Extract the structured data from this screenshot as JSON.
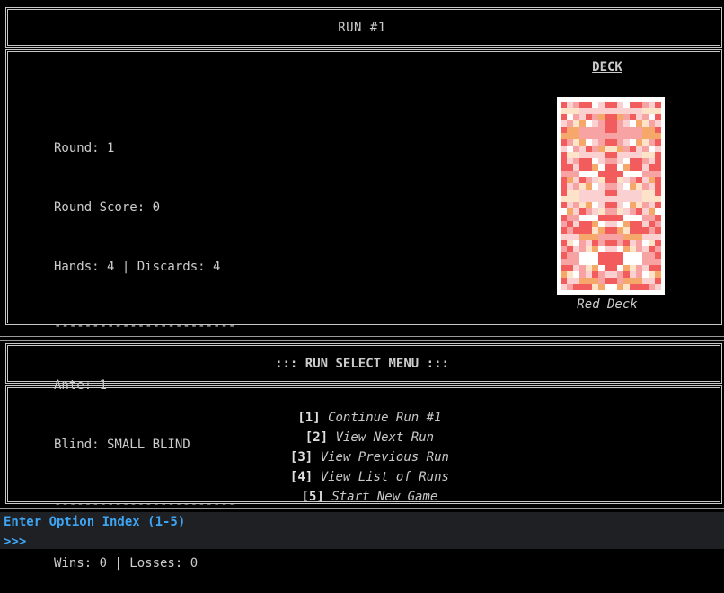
{
  "run_title": "RUN #1",
  "stats": {
    "round": "Round: 1",
    "round_score": "Round Score: 0",
    "hands_discards": "Hands: 4 | Discards: 4",
    "divider1": "------------------------",
    "ante": "Ante: 1",
    "blind": "Blind: SMALL BLIND",
    "divider2": "------------------------",
    "wins_losses": "Wins: 0 | Losses: 0"
  },
  "deck": {
    "heading": "DECK",
    "name": "Red Deck",
    "card_colors": {
      "base": "#ffffff",
      "red": "#f25c5c",
      "pink": "#f7a3a3",
      "light": "#fbd0d0",
      "orange": "#f6a86a",
      "cream": "#fde3c8"
    }
  },
  "menu": {
    "title": "::: RUN SELECT MENU :::",
    "items": [
      {
        "index": "[1]",
        "label": "Continue Run #1"
      },
      {
        "index": "[2]",
        "label": "View Next Run"
      },
      {
        "index": "[3]",
        "label": "View Previous Run"
      },
      {
        "index": "[4]",
        "label": "View List of Runs"
      },
      {
        "index": "[5]",
        "label": "Start New Game"
      }
    ]
  },
  "prompt": {
    "text": "Enter Option Index (1-5)",
    "caret": ">>>"
  }
}
